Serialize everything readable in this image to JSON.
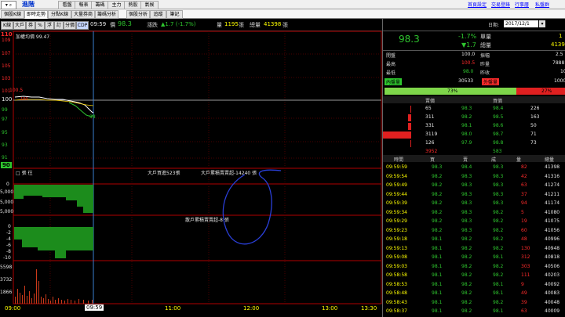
{
  "topbar": {
    "code": "進階",
    "buttons": [
      "看盤",
      "報表",
      "籌碼",
      "主力",
      "熱股",
      "氣候"
    ],
    "links": [
      "首頁設定",
      "交易登錄",
      "行事曆",
      "私盤群"
    ]
  },
  "tabs": [
    "個股K線",
    "即時走勢",
    "分點K線",
    "大量券商",
    "籌碼分析",
    "個股分析",
    "追蹤",
    "筆記"
  ],
  "toolbar": {
    "buttons": [
      "K線",
      "大戶",
      "券",
      "%",
      "浮",
      "訂",
      "分價",
      "CDP"
    ],
    "time": "09:59",
    "price_label": "價",
    "price": "98.3",
    "change_label": "漲跌",
    "change": "▲1.7 (-1.7%)",
    "vol_label": "量",
    "vol": "1195",
    "vol_unit": "張",
    "total_label": "總量",
    "total": "41398",
    "total_unit": "張"
  },
  "chart": {
    "legend": "加權均價 99.47",
    "y_labels": [
      "110",
      "109",
      "107",
      "105",
      "103",
      "101",
      "100",
      "99",
      "97",
      "95",
      "93",
      "91",
      "90"
    ],
    "ref_left": "100.5",
    "ref_value": "100",
    "low_marker": "98",
    "panel2": {
      "label": "□ 張 往",
      "left_vals": [
        "0",
        "5,000",
        "5,000",
        "5,000"
      ],
      "note1": "大戶買進523張",
      "note2": "大戶累積賣賣超-14240 張"
    },
    "panel3": {
      "note": "散戶累積賣賣超-8 張",
      "left_vals": [
        "0",
        "-2",
        "-4",
        "-6",
        "-8",
        "-10"
      ]
    },
    "panel4": {
      "left_vals": [
        "5598",
        "3732",
        "1866"
      ]
    },
    "x_labels": [
      "09:00",
      "09:59",
      "11:00",
      "12:00",
      "13:00",
      "13:30"
    ]
  },
  "side": {
    "date_label": "日期:",
    "date": "2017/12/1",
    "symbol_price": "98.3",
    "pct": "-1.7%",
    "diff": "▼1.7",
    "single_label": "單量",
    "single_val": "1",
    "total_label": "總量",
    "total_val": "4139",
    "open_label": "開盤",
    "open_val": "100.0",
    "amp_label": "振幅",
    "amp_val": "2.5",
    "high_label": "最高",
    "high_val": "100.5",
    "ratio_label": "昨量",
    "ratio_val": "7888",
    "low_label": "最低",
    "low_val": "98.0",
    "prev_label": "昨收",
    "prev_val": "10",
    "inner_label": "內盤量",
    "inner_val": "30533",
    "outer_label": "外盤量",
    "outer_val": "1000",
    "buy_pct": "73%",
    "sell_pct": "27%",
    "buy_pct_value": 73,
    "book_headers": [
      "賣價",
      "買價"
    ],
    "book": [
      {
        "bq": "65",
        "bp": "98.3",
        "sp": "98.4",
        "sq": "226"
      },
      {
        "bq": "311",
        "bp": "98.2",
        "sp": "98.5",
        "sq": "163"
      },
      {
        "bq": "331",
        "bp": "98.1",
        "sp": "98.6",
        "sq": "50"
      },
      {
        "bq": "3119",
        "bp": "98.0",
        "sp": "98.7",
        "sq": "71"
      },
      {
        "bq": "126",
        "bp": "97.9",
        "sp": "98.8",
        "sq": "73"
      }
    ],
    "book_totals": {
      "buy": "3952",
      "sell": "583"
    },
    "trades_headers": [
      "時間",
      "買",
      "賣",
      "成",
      "量",
      "總量"
    ],
    "trades": [
      {
        "t": "09:59:59",
        "b": "98.3",
        "s": "98.4",
        "p": "98.3",
        "q": "82",
        "tot": "41398"
      },
      {
        "t": "09:59:54",
        "b": "98.2",
        "s": "98.3",
        "p": "98.3",
        "q": "42",
        "tot": "41316"
      },
      {
        "t": "09:59:49",
        "b": "98.2",
        "s": "98.3",
        "p": "98.3",
        "q": "63",
        "tot": "41274"
      },
      {
        "t": "09:59:44",
        "b": "98.2",
        "s": "98.3",
        "p": "98.3",
        "q": "37",
        "tot": "41211"
      },
      {
        "t": "09:59:39",
        "b": "98.2",
        "s": "98.3",
        "p": "98.3",
        "q": "94",
        "tot": "41174"
      },
      {
        "t": "09:59:34",
        "b": "98.2",
        "s": "98.3",
        "p": "98.2",
        "q": "5",
        "tot": "41080"
      },
      {
        "t": "09:59:29",
        "b": "98.2",
        "s": "98.3",
        "p": "98.2",
        "q": "19",
        "tot": "41075"
      },
      {
        "t": "09:59:23",
        "b": "98.2",
        "s": "98.3",
        "p": "98.2",
        "q": "60",
        "tot": "41056"
      },
      {
        "t": "09:59:18",
        "b": "98.1",
        "s": "98.2",
        "p": "98.2",
        "q": "48",
        "tot": "40996"
      },
      {
        "t": "09:59:13",
        "b": "98.1",
        "s": "98.2",
        "p": "98.2",
        "q": "130",
        "tot": "40948"
      },
      {
        "t": "09:59:08",
        "b": "98.1",
        "s": "98.2",
        "p": "98.1",
        "q": "312",
        "tot": "40818"
      },
      {
        "t": "09:59:03",
        "b": "98.1",
        "s": "98.2",
        "p": "98.2",
        "q": "303",
        "tot": "40506"
      },
      {
        "t": "09:58:58",
        "b": "98.1",
        "s": "98.2",
        "p": "98.2",
        "q": "111",
        "tot": "40203"
      },
      {
        "t": "09:58:53",
        "b": "98.1",
        "s": "98.2",
        "p": "98.1",
        "q": "9",
        "tot": "40092"
      },
      {
        "t": "09:58:48",
        "b": "98.1",
        "s": "98.2",
        "p": "98.1",
        "q": "49",
        "tot": "40083"
      },
      {
        "t": "09:58:43",
        "b": "98.1",
        "s": "98.2",
        "p": "98.2",
        "q": "39",
        "tot": "40048"
      },
      {
        "t": "09:58:37",
        "b": "98.1",
        "s": "98.2",
        "p": "98.1",
        "q": "63",
        "tot": "40009"
      }
    ]
  }
}
